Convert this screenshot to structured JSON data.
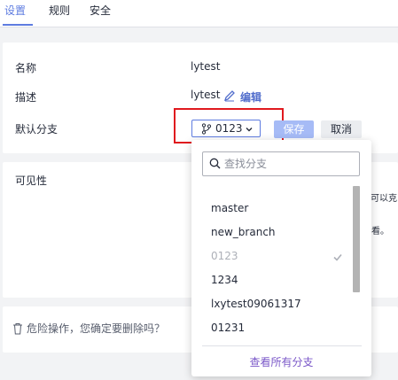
{
  "tabs": [
    {
      "label": "设置",
      "active": true
    },
    {
      "label": "规则",
      "active": false
    },
    {
      "label": "安全",
      "active": false
    }
  ],
  "settings": {
    "name_label": "名称",
    "name_value": "lytest",
    "desc_label": "描述",
    "desc_value": "lytest",
    "edit_label": "编辑",
    "branch_label": "默认分支",
    "branch_value": "0123",
    "save_label": "保存",
    "cancel_label": "取消"
  },
  "visibility": {
    "label": "可见性",
    "partial_line1": "可以克",
    "partial_line2": "看。"
  },
  "danger": {
    "text": "危险操作，您确定要删除吗？"
  },
  "dropdown": {
    "search_placeholder": "查找分支",
    "options": [
      "master",
      "new_branch",
      "0123",
      "1234",
      "lxytest09061317",
      "01231"
    ],
    "selected": "0123",
    "view_all_label": "查看所有分支"
  },
  "colors": {
    "accent": "#5e7ce0",
    "highlight_box": "#e0191e",
    "view_all": "#7a57c8"
  }
}
